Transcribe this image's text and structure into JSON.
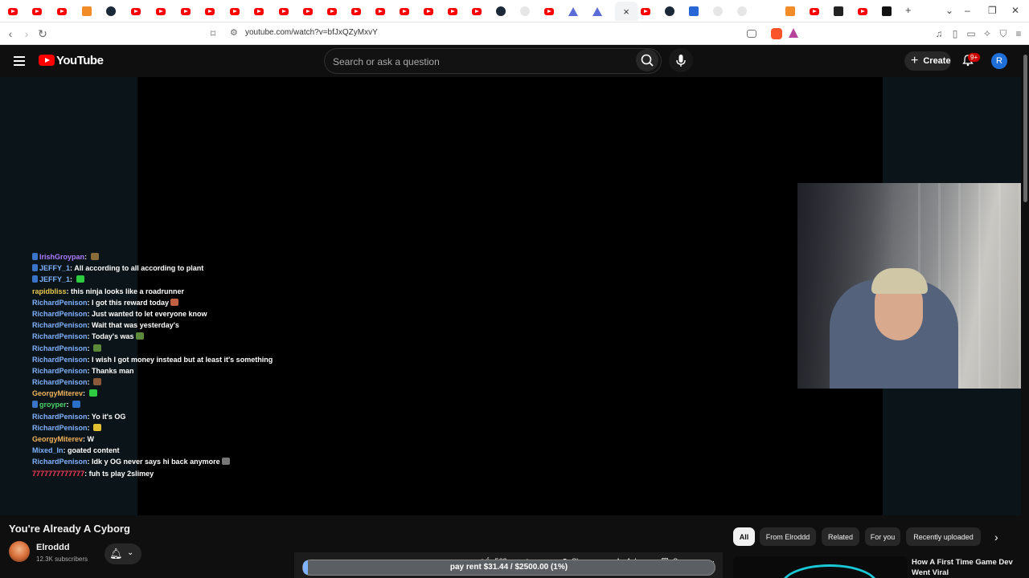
{
  "browser": {
    "url": "youtube.com/watch?v=bfJxQZyMxvY",
    "active_tab_close": "×",
    "new_tab": "+"
  },
  "header": {
    "logo_text": "YouTube",
    "search_placeholder": "Search or ask a question",
    "create_label": "Create",
    "notifications_count": "9+",
    "avatar_letter": "R"
  },
  "chat": {
    "messages": [
      {
        "user": "IrishGroypan",
        "text": "",
        "color": "#b07cff",
        "emote": "#8a6b3a",
        "badge": true
      },
      {
        "user": "JEFFY_1",
        "text": "All according to all according to plant",
        "color": "#7fb2ff",
        "emote": "",
        "badge": true
      },
      {
        "user": "JEFFY_1",
        "text": "",
        "color": "#7fb2ff",
        "emote": "#2ecc40",
        "badge": true
      },
      {
        "user": "rapidbliss",
        "text": "this ninja looks like a roadrunner",
        "color": "#e8c84b",
        "emote": "",
        "badge": false
      },
      {
        "user": "RichardPenison",
        "text": "I got this reward today",
        "color": "#7fb2ff",
        "emote": "#c06040",
        "badge": false
      },
      {
        "user": "RichardPenison",
        "text": "Just wanted to let everyone know",
        "color": "#7fb2ff",
        "emote": "",
        "badge": false
      },
      {
        "user": "RichardPenison",
        "text": "Wait that was yesterday's",
        "color": "#7fb2ff",
        "emote": "",
        "badge": false
      },
      {
        "user": "RichardPenison",
        "text": "Today's was",
        "color": "#7fb2ff",
        "emote": "#5a8a3a",
        "badge": false
      },
      {
        "user": "RichardPenison",
        "text": "",
        "color": "#7fb2ff",
        "emote": "#5a8a3a",
        "badge": false
      },
      {
        "user": "RichardPenison",
        "text": "I wish I got money instead but at least it's something",
        "color": "#7fb2ff",
        "emote": "",
        "badge": false
      },
      {
        "user": "RichardPenison",
        "text": "Thanks man",
        "color": "#7fb2ff",
        "emote": "",
        "badge": false
      },
      {
        "user": "RichardPenison",
        "text": "",
        "color": "#7fb2ff",
        "emote": "#8a5a3a",
        "badge": false
      },
      {
        "user": "GeorgyMiterev",
        "text": "",
        "color": "#f0b35a",
        "emote": "#2ecc40",
        "badge": false
      },
      {
        "user": "groyper",
        "text": "",
        "color": "#4ad36b",
        "emote": "#2a70c8",
        "badge": true
      },
      {
        "user": "RichardPenison",
        "text": "Yo it's OG",
        "color": "#7fb2ff",
        "emote": "",
        "badge": false
      },
      {
        "user": "RichardPenison",
        "text": "",
        "color": "#7fb2ff",
        "emote": "#e0c030",
        "badge": false
      },
      {
        "user": "GeorgyMiterev",
        "text": "W",
        "color": "#f0b35a",
        "emote": "",
        "badge": false
      },
      {
        "user": "Mixed_In",
        "text": "goated content",
        "color": "#7fb2ff",
        "emote": "",
        "badge": false
      },
      {
        "user": "RichardPenison",
        "text": "Idk y OG never says hi back anymore",
        "color": "#7fb2ff",
        "emote": "#777777",
        "badge": false
      },
      {
        "user": "7777777777777",
        "text": "fuh ts play 2slimey",
        "color": "#ff3b5c",
        "emote": "",
        "badge": false
      }
    ]
  },
  "video": {
    "title": "You're Already A Cyborg",
    "channel_name": "Elroddd",
    "subscribers": "12.3K subscribers",
    "likes": "562",
    "share_label": "Share",
    "ask_label": "Ask",
    "save_label": "Save",
    "more_label": "···"
  },
  "donation": {
    "text": "pay rent $31.44 / $2500.00 (1%)",
    "progress_fraction": 0.0126
  },
  "chips": [
    "All",
    "From Elroddd",
    "Related",
    "For you",
    "Recently uploaded"
  ],
  "recommendation": {
    "title": "How A First Time Game Dev Went Viral"
  }
}
